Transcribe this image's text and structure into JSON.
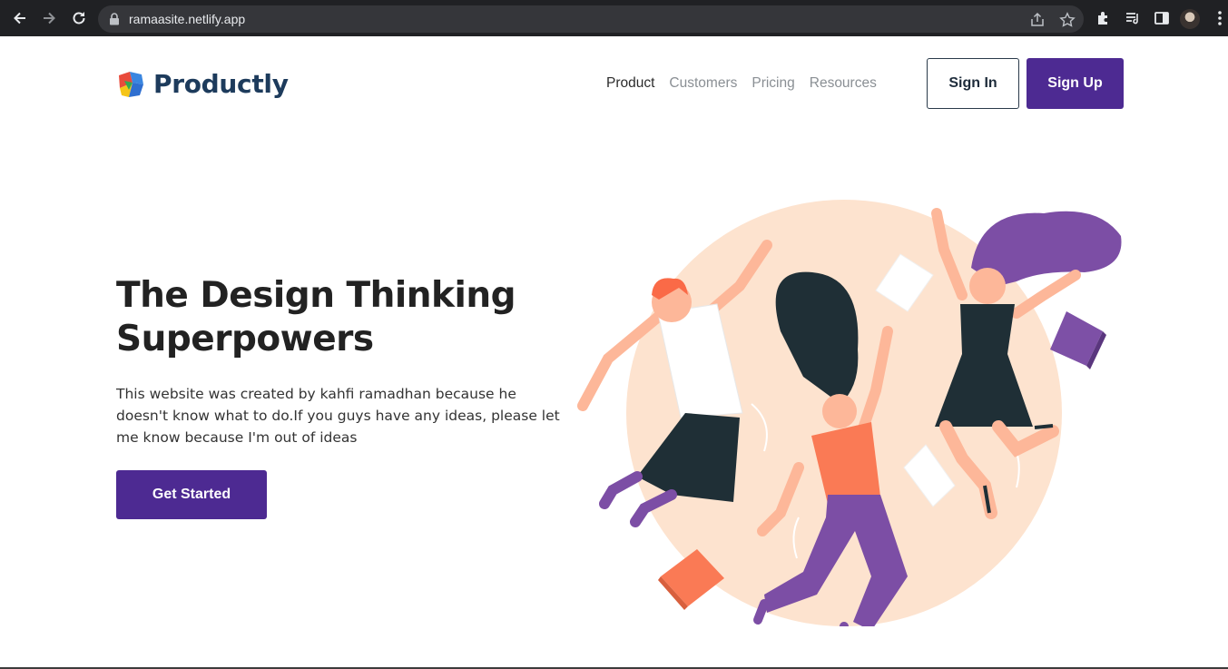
{
  "browser": {
    "url": "ramaasite.netlify.app",
    "icons": [
      "back-icon",
      "forward-icon",
      "reload-icon",
      "lock-icon",
      "share-icon",
      "star-icon",
      "extensions-icon",
      "reading-list-icon",
      "side-panel-icon",
      "profile-avatar",
      "menu-icon"
    ]
  },
  "brand": {
    "name": "Productly",
    "colors": {
      "primary": "#4d2a92",
      "heading": "#1d3b5c"
    }
  },
  "nav": {
    "items": [
      {
        "label": "Product",
        "active": true
      },
      {
        "label": "Customers",
        "active": false
      },
      {
        "label": "Pricing",
        "active": false
      },
      {
        "label": "Resources",
        "active": false
      }
    ]
  },
  "auth": {
    "sign_in": "Sign In",
    "sign_up": "Sign Up"
  },
  "hero": {
    "title_line1": "The Design Thinking",
    "title_line2": "Superpowers",
    "description": "This website was created by kahfi ramadhan because he doesn't know what to do.If you guys have any ideas, please let me know because I'm out of ideas",
    "cta": "Get Started"
  }
}
